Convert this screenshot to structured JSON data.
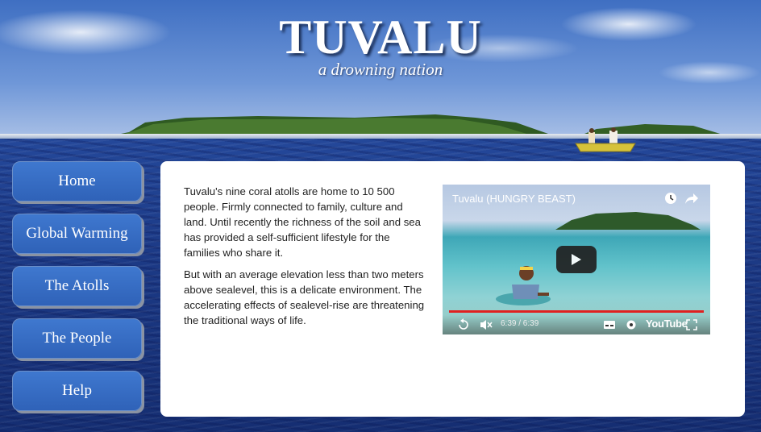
{
  "header": {
    "title": "TUVALU",
    "subtitle": "a drowning nation"
  },
  "nav": {
    "items": [
      {
        "label": "Home"
      },
      {
        "label": "Global Warming"
      },
      {
        "label": "The Atolls"
      },
      {
        "label": "The People"
      },
      {
        "label": "Help"
      }
    ]
  },
  "content": {
    "paragraph1": "Tuvalu's nine coral atolls are home to 10 500 people. Firmly connected to family, culture and land. Until recently the richness of the soil and sea has provided a self-sufficient lifestyle for the families who share it.",
    "paragraph2": "But with an average elevation less than two meters above sealevel, this is a delicate environment. The accelerating effects of sealevel-rise are threatening the traditional ways of life."
  },
  "video": {
    "title": "Tuvalu (HUNGRY BEAST)",
    "time": "6:39 / 6:39",
    "brand": "YouTube",
    "progress": 1.0
  },
  "colors": {
    "nav_button": "#3a70c8",
    "sky": "#4f7fcf",
    "ocean": "#1c3a86",
    "progress": "#e02020"
  }
}
